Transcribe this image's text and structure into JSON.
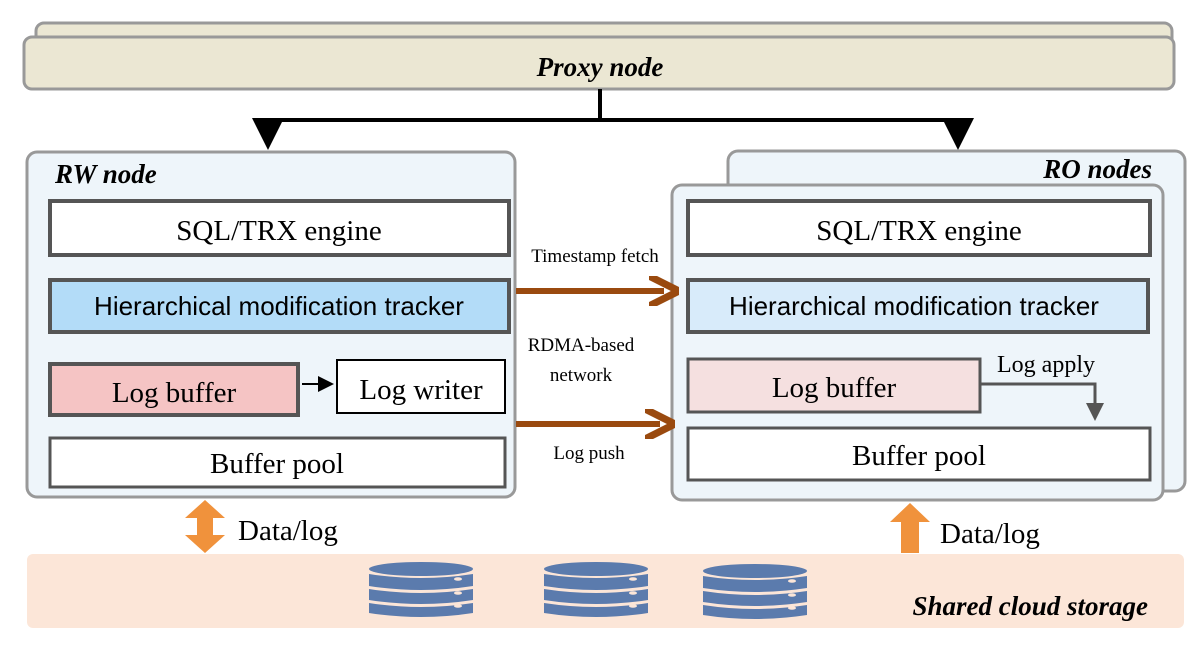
{
  "proxy": {
    "label": "Proxy node"
  },
  "rw": {
    "title": "RW node",
    "sql": "SQL/TRX engine",
    "tracker": "Hierarchical modification tracker",
    "log_buffer": "Log buffer",
    "log_writer": "Log writer",
    "buffer_pool": "Buffer pool"
  },
  "ro": {
    "title": "RO nodes",
    "sql": "SQL/TRX engine",
    "tracker": "Hierarchical modification tracker",
    "log_buffer": "Log buffer",
    "log_apply": "Log apply",
    "buffer_pool": "Buffer pool"
  },
  "network": {
    "timestamp_fetch": "Timestamp fetch",
    "rdma_line1": "RDMA-based",
    "rdma_line2": "network",
    "log_push": "Log push"
  },
  "storage": {
    "label": "Shared cloud storage",
    "rw_link": "Data/log",
    "ro_link": "Data/log",
    "icons": [
      "database-icon",
      "database-icon",
      "database-icon"
    ]
  },
  "colors": {
    "proxy_fill": "#ebe7d3",
    "node_fill": "#eef5fa",
    "rw_tracker_fill": "#b3dcf8",
    "ro_tracker_fill": "#d8ebfa",
    "rw_log_buffer_fill": "#f5c4c4",
    "ro_log_buffer_fill": "#f5e0e0",
    "network_arrow": "#9a4a0f",
    "storage_fill": "#fce6d8",
    "storage_arrow": "#f0923c",
    "database": "#5b7bad"
  }
}
